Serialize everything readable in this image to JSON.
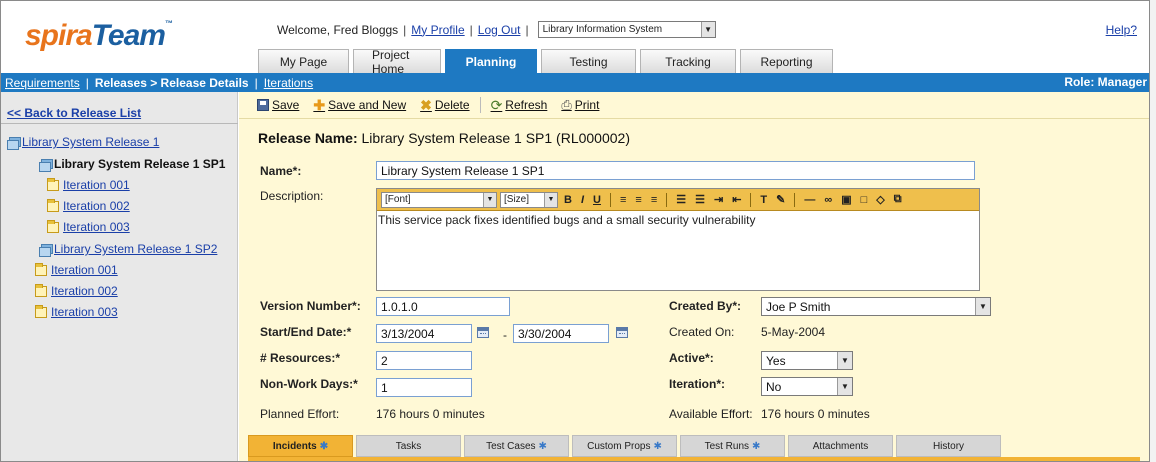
{
  "header": {
    "logo_spira": "spira",
    "logo_team": "Team",
    "logo_tm": "™",
    "welcome": "Welcome, Fred Bloggs",
    "my_profile": "My Profile",
    "log_out": "Log Out",
    "project_selected": "Library Information System",
    "help": "Help?"
  },
  "tabs": [
    {
      "label": "My Page"
    },
    {
      "label": "Project Home"
    },
    {
      "label": "Planning"
    },
    {
      "label": "Testing"
    },
    {
      "label": "Tracking"
    },
    {
      "label": "Reporting"
    }
  ],
  "subnav": {
    "requirements": "Requirements",
    "current": "Releases > Release Details",
    "iterations": "Iterations",
    "role": "Role: Manager"
  },
  "sidebar": {
    "back": "<< Back to Release List",
    "tree": [
      {
        "label": "Library System Release 1"
      },
      {
        "label": "Library System Release 1 SP1"
      },
      {
        "label": "Iteration 001"
      },
      {
        "label": "Iteration 002"
      },
      {
        "label": "Iteration 003"
      },
      {
        "label": "Library System Release 1 SP2"
      },
      {
        "label": "Iteration 001"
      },
      {
        "label": "Iteration 002"
      },
      {
        "label": "Iteration 003"
      }
    ]
  },
  "toolbar": {
    "save": "Save",
    "save_new": "Save and New",
    "delete": "Delete",
    "refresh": "Refresh",
    "print": "Print"
  },
  "release": {
    "title_label": "Release Name:",
    "title_value": "Library System Release 1 SP1 (RL000002)"
  },
  "form": {
    "name_label": "Name*:",
    "name_value": "Library System Release 1 SP1",
    "description_label": "Description:",
    "font_select": "[Font]",
    "size_select": "[Size]",
    "description_value": "This service pack fixes identified bugs and a small security vulnerability",
    "version_label": "Version Number*:",
    "version_value": "1.0.1.0",
    "dates_label": "Start/End Date:*",
    "start_date": "3/13/2004",
    "date_dash": "-",
    "end_date": "3/30/2004",
    "resources_label": "# Resources:*",
    "resources_value": "2",
    "nonwork_label": "Non-Work Days:*",
    "nonwork_value": "1",
    "planned_label": "Planned Effort:",
    "planned_value": "176 hours 0 minutes",
    "created_by_label": "Created By*:",
    "created_by_value": "Joe P Smith",
    "created_on_label": "Created On:",
    "created_on_value": "5-May-2004",
    "active_label": "Active*:",
    "active_value": "Yes",
    "iteration_label": "Iteration*:",
    "iteration_value": "No",
    "available_label": "Available Effort:",
    "available_value": "176 hours 0 minutes"
  },
  "bottom_tabs": [
    {
      "label": "Incidents",
      "star": "✱"
    },
    {
      "label": "Tasks",
      "star": ""
    },
    {
      "label": "Test Cases",
      "star": "✱"
    },
    {
      "label": "Custom Props",
      "star": "✱"
    },
    {
      "label": "Test Runs",
      "star": "✱"
    },
    {
      "label": "Attachments",
      "star": ""
    },
    {
      "label": "History",
      "star": ""
    }
  ],
  "colors": {
    "brand_orange": "#e8741c",
    "brand_blue": "#1e79c2",
    "panel_yellow": "#fff9d6",
    "tab_active_orange": "#f2b335"
  }
}
